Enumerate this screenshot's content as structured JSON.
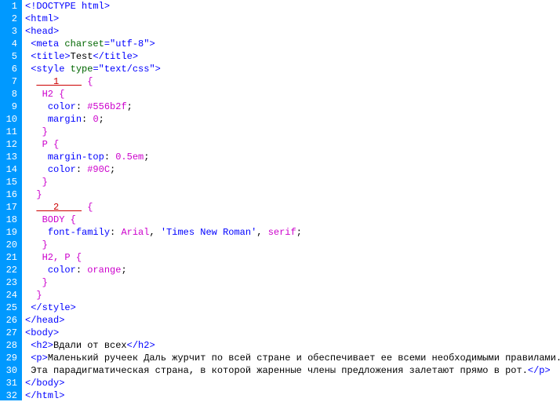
{
  "lines": [
    {
      "num": 1,
      "indent": 0,
      "tokens": [
        {
          "c": "t-tag",
          "t": "<!DOCTYPE html>"
        }
      ]
    },
    {
      "num": 2,
      "indent": 0,
      "tokens": [
        {
          "c": "t-tag",
          "t": "<html>"
        }
      ]
    },
    {
      "num": 3,
      "indent": 0,
      "tokens": [
        {
          "c": "t-tag",
          "t": "<head>"
        }
      ]
    },
    {
      "num": 4,
      "indent": 1,
      "tokens": [
        {
          "c": "t-tag",
          "t": "<meta "
        },
        {
          "c": "t-attrname",
          "t": "charset"
        },
        {
          "c": "t-tag",
          "t": "="
        },
        {
          "c": "t-attrval",
          "t": "\"utf-8\""
        },
        {
          "c": "t-tag",
          "t": ">"
        }
      ]
    },
    {
      "num": 5,
      "indent": 1,
      "tokens": [
        {
          "c": "t-tag",
          "t": "<title>"
        },
        {
          "c": "t-text",
          "t": "Test"
        },
        {
          "c": "t-tag",
          "t": "</title>"
        }
      ]
    },
    {
      "num": 6,
      "indent": 1,
      "tokens": [
        {
          "c": "t-tag",
          "t": "<style "
        },
        {
          "c": "t-attrname",
          "t": "type"
        },
        {
          "c": "t-tag",
          "t": "="
        },
        {
          "c": "t-attrval",
          "t": "\"text/css\""
        },
        {
          "c": "t-tag",
          "t": ">"
        }
      ]
    },
    {
      "num": 7,
      "indent": 2,
      "tokens": [
        {
          "c": "t-blank",
          "t": "   1    "
        },
        {
          "c": "t-sel",
          "t": " {"
        }
      ]
    },
    {
      "num": 8,
      "indent": 2,
      "tokens": [
        {
          "c": "t-sel",
          "t": " H2 {"
        }
      ]
    },
    {
      "num": 9,
      "indent": 2,
      "tokens": [
        {
          "c": "t-text",
          "t": "  "
        },
        {
          "c": "t-prop",
          "t": "color"
        },
        {
          "c": "t-text",
          "t": ": "
        },
        {
          "c": "t-val",
          "t": "#556b2f"
        },
        {
          "c": "t-text",
          "t": ";"
        }
      ]
    },
    {
      "num": 10,
      "indent": 2,
      "tokens": [
        {
          "c": "t-text",
          "t": "  "
        },
        {
          "c": "t-prop",
          "t": "margin"
        },
        {
          "c": "t-text",
          "t": ": "
        },
        {
          "c": "t-val",
          "t": "0"
        },
        {
          "c": "t-text",
          "t": ";"
        }
      ]
    },
    {
      "num": 11,
      "indent": 2,
      "tokens": [
        {
          "c": "t-sel",
          "t": " }"
        }
      ]
    },
    {
      "num": 12,
      "indent": 2,
      "tokens": [
        {
          "c": "t-sel",
          "t": " P {"
        }
      ]
    },
    {
      "num": 13,
      "indent": 2,
      "tokens": [
        {
          "c": "t-text",
          "t": "  "
        },
        {
          "c": "t-prop",
          "t": "margin-top"
        },
        {
          "c": "t-text",
          "t": ": "
        },
        {
          "c": "t-val",
          "t": "0.5em"
        },
        {
          "c": "t-text",
          "t": ";"
        }
      ]
    },
    {
      "num": 14,
      "indent": 2,
      "tokens": [
        {
          "c": "t-text",
          "t": "  "
        },
        {
          "c": "t-prop",
          "t": "color"
        },
        {
          "c": "t-text",
          "t": ": "
        },
        {
          "c": "t-val",
          "t": "#90C"
        },
        {
          "c": "t-text",
          "t": ";"
        }
      ]
    },
    {
      "num": 15,
      "indent": 2,
      "tokens": [
        {
          "c": "t-sel",
          "t": " }"
        }
      ]
    },
    {
      "num": 16,
      "indent": 2,
      "tokens": [
        {
          "c": "t-sel",
          "t": "}"
        }
      ]
    },
    {
      "num": 17,
      "indent": 2,
      "tokens": [
        {
          "c": "t-blank",
          "t": "   2    "
        },
        {
          "c": "t-sel",
          "t": " {"
        }
      ]
    },
    {
      "num": 18,
      "indent": 2,
      "tokens": [
        {
          "c": "t-sel",
          "t": " BODY {"
        }
      ]
    },
    {
      "num": 19,
      "indent": 2,
      "tokens": [
        {
          "c": "t-text",
          "t": "  "
        },
        {
          "c": "t-prop",
          "t": "font-family"
        },
        {
          "c": "t-text",
          "t": ": "
        },
        {
          "c": "t-val",
          "t": "Arial"
        },
        {
          "c": "t-text",
          "t": ", "
        },
        {
          "c": "t-quoted",
          "t": "'Times New Roman'"
        },
        {
          "c": "t-text",
          "t": ", "
        },
        {
          "c": "t-val",
          "t": "serif"
        },
        {
          "c": "t-text",
          "t": ";"
        }
      ]
    },
    {
      "num": 20,
      "indent": 2,
      "tokens": [
        {
          "c": "t-sel",
          "t": " }"
        }
      ]
    },
    {
      "num": 21,
      "indent": 2,
      "tokens": [
        {
          "c": "t-sel",
          "t": " H2, P {"
        }
      ]
    },
    {
      "num": 22,
      "indent": 2,
      "tokens": [
        {
          "c": "t-text",
          "t": "  "
        },
        {
          "c": "t-prop",
          "t": "color"
        },
        {
          "c": "t-text",
          "t": ": "
        },
        {
          "c": "t-val",
          "t": "orange"
        },
        {
          "c": "t-text",
          "t": ";"
        }
      ]
    },
    {
      "num": 23,
      "indent": 2,
      "tokens": [
        {
          "c": "t-sel",
          "t": " }"
        }
      ]
    },
    {
      "num": 24,
      "indent": 2,
      "tokens": [
        {
          "c": "t-sel",
          "t": "}"
        }
      ]
    },
    {
      "num": 25,
      "indent": 1,
      "tokens": [
        {
          "c": "t-tag",
          "t": "</style>"
        }
      ]
    },
    {
      "num": 26,
      "indent": 0,
      "tokens": [
        {
          "c": "t-tag",
          "t": "</head>"
        }
      ]
    },
    {
      "num": 27,
      "indent": 0,
      "tokens": [
        {
          "c": "t-tag",
          "t": "<body>"
        }
      ]
    },
    {
      "num": 28,
      "indent": 1,
      "tokens": [
        {
          "c": "t-tag",
          "t": "<h2>"
        },
        {
          "c": "t-text",
          "t": "Вдали от всех"
        },
        {
          "c": "t-tag",
          "t": "</h2>"
        }
      ]
    },
    {
      "num": 29,
      "indent": 1,
      "tokens": [
        {
          "c": "t-tag",
          "t": "<p>"
        },
        {
          "c": "t-text",
          "t": "Маленький ручеек Даль журчит по всей стране и обеспечивает ее всеми необходимыми правилами."
        }
      ]
    },
    {
      "num": 30,
      "indent": 1,
      "tokens": [
        {
          "c": "t-text",
          "t": "Эта парадигматическая страна, в которой жаренные члены предложения залетают прямо в рот."
        },
        {
          "c": "t-tag",
          "t": "</p>"
        }
      ]
    },
    {
      "num": 31,
      "indent": 0,
      "tokens": [
        {
          "c": "t-tag",
          "t": "</body>"
        }
      ]
    },
    {
      "num": 32,
      "indent": 0,
      "tokens": [
        {
          "c": "t-tag",
          "t": "</html>"
        }
      ]
    }
  ]
}
